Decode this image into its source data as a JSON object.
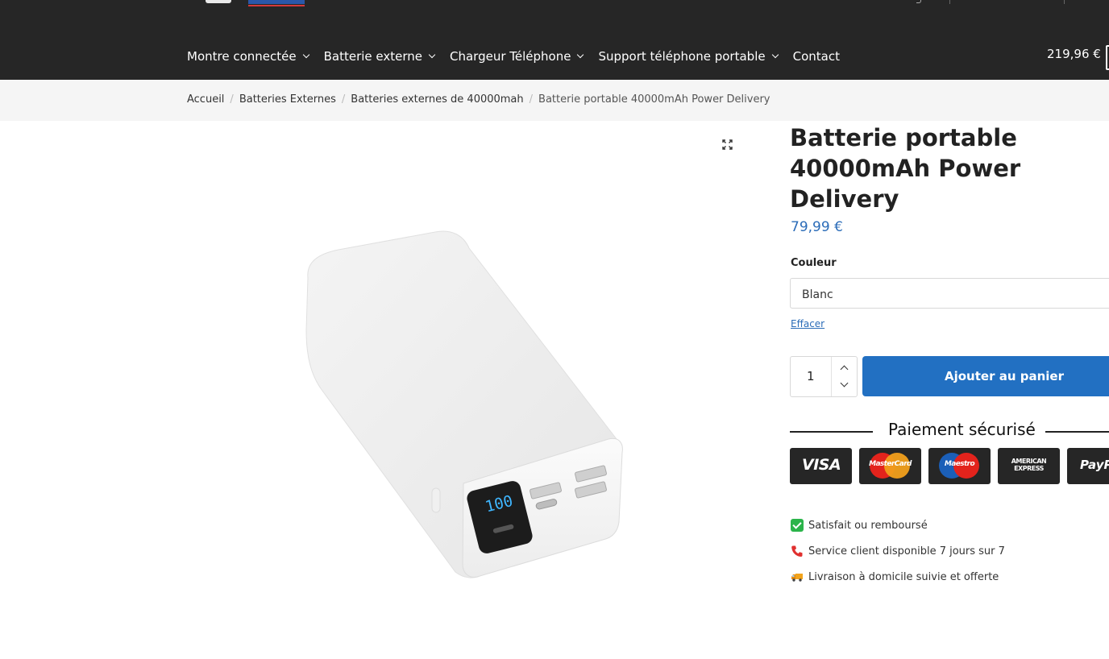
{
  "header": {
    "nav": [
      {
        "label": "Montre connectée",
        "has_dropdown": true
      },
      {
        "label": "Batterie externe",
        "has_dropdown": true
      },
      {
        "label": "Chargeur Téléphone",
        "has_dropdown": true
      },
      {
        "label": "Support téléphone portable",
        "has_dropdown": true
      },
      {
        "label": "Contact",
        "has_dropdown": false
      }
    ],
    "cart_total": "219,96 €"
  },
  "breadcrumb": [
    "Accueil",
    "Batteries Externes",
    "Batteries externes de 40000mah",
    "Batterie portable 40000mAh Power Delivery"
  ],
  "gallery": {
    "display_reading": "100"
  },
  "product": {
    "title": "Batterie portable 40000mAh Power Delivery",
    "price": "79,99 €",
    "color_label": "Couleur",
    "color_selected": "Blanc",
    "clear_label": "Effacer",
    "quantity": "1",
    "add_to_cart": "Ajouter au panier"
  },
  "payment": {
    "title": "Paiement sécurisé",
    "cards": [
      {
        "name": "VISA",
        "icon": "visa-card-icon"
      },
      {
        "name": "MasterCard",
        "icon": "mastercard-icon"
      },
      {
        "name": "Maestro",
        "icon": "maestro-icon"
      },
      {
        "name": "AMERICAN EXPRESS",
        "icon": "amex-icon"
      },
      {
        "name": "PayPal",
        "icon": "paypal-icon"
      }
    ]
  },
  "features": [
    {
      "icon": "check-icon",
      "text": "Satisfait ou remboursé"
    },
    {
      "icon": "phone-icon",
      "text": "Service client disponible 7 jours sur 7"
    },
    {
      "icon": "truck-icon",
      "text": "Livraison à domicile suivie et offerte"
    }
  ],
  "colors": {
    "topbar": "#262626",
    "accent": "#2270c2",
    "price": "#2b6cb8",
    "crumbbar": "#f5f5f5"
  }
}
